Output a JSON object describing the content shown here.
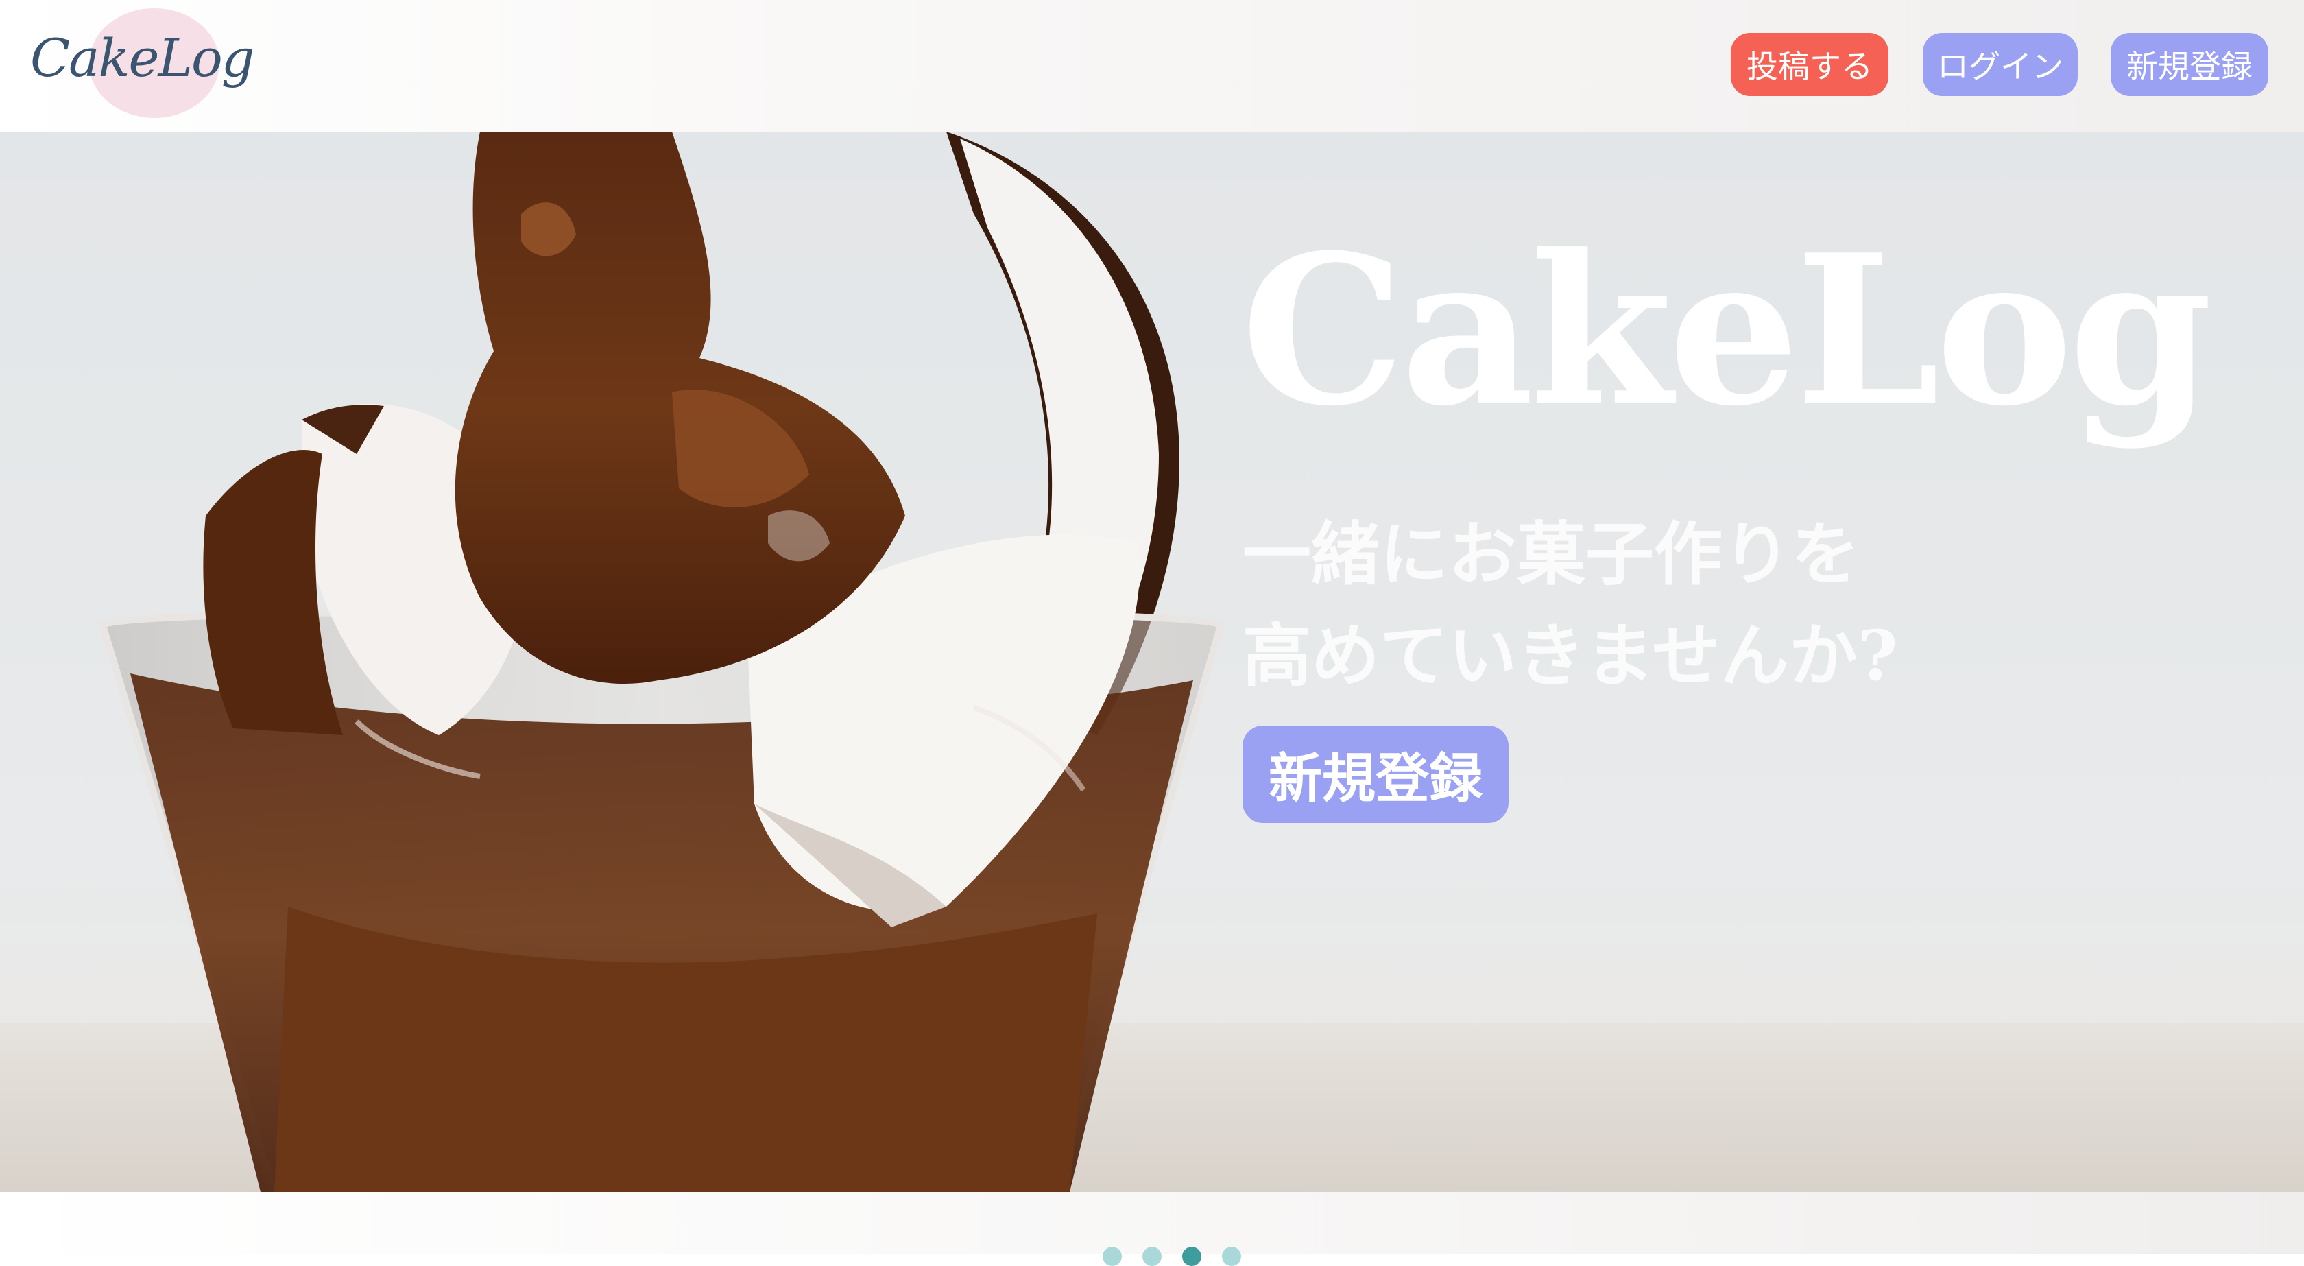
{
  "header": {
    "logo_text": "CakeLog",
    "nav": {
      "post_label": "投稿する",
      "login_label": "ログイン",
      "signup_label": "新規登録"
    }
  },
  "hero": {
    "title": "CakeLog",
    "subtitle_line1": "一緒にお菓子作りを",
    "subtitle_line2": "高めていきませんか?",
    "cta_label": "新規登録"
  },
  "carousel": {
    "dot_count": 4,
    "active_index": 2
  },
  "colors": {
    "post_button": "#f56154",
    "accent_button": "#9ba1f2",
    "logo_text": "#3b5570",
    "logo_blob": "#f6dfe6",
    "dot_active": "#3f9c9c",
    "dot_inactive": "#a9d8d8"
  }
}
